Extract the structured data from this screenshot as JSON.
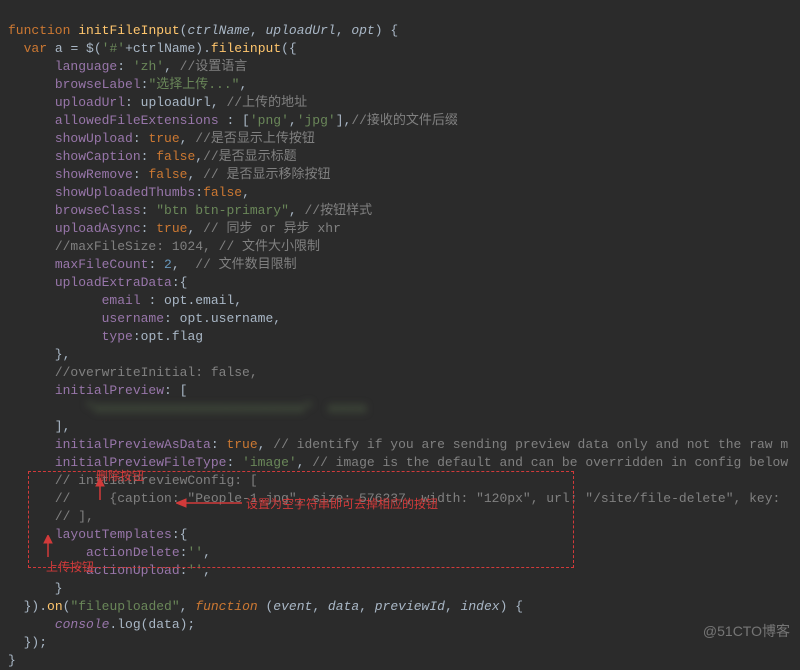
{
  "code": {
    "fn_decl_kw": "function",
    "fn_name": "initFileInput",
    "params": [
      "ctrlName",
      "uploadUrl",
      "opt"
    ],
    "var_kw": "var",
    "var_a": "a",
    "jq_prefix": "$(",
    "hash": "'#'",
    "plus": "+",
    "ctrl": "ctrlName",
    "fileinput": "fileinput",
    "opts": {
      "language": {
        "k": "language",
        "v": "'zh'",
        "c": "//设置语言"
      },
      "browseLabel": {
        "k": "browseLabel",
        "v": "\"选择上传...\""
      },
      "uploadUrl": {
        "k": "uploadUrl",
        "v": "uploadUrl",
        "c": "//上传的地址"
      },
      "allowedFileExtensions": {
        "k": "allowedFileExtensions",
        "v": "['png','jpg']",
        "c": "//接收的文件后缀"
      },
      "showUpload": {
        "k": "showUpload",
        "v": "true",
        "c": "//是否显示上传按钮"
      },
      "showCaption": {
        "k": "showCaption",
        "v": "false",
        "c": "//是否显示标题"
      },
      "showRemove": {
        "k": "showRemove",
        "v": "false",
        "c": "// 是否显示移除按钮"
      },
      "showUploadedThumbs": {
        "k": "showUploadedThumbs",
        "v": "false"
      },
      "browseClass": {
        "k": "browseClass",
        "v": "\"btn btn-primary\"",
        "c": "//按钮样式"
      },
      "uploadAsync": {
        "k": "uploadAsync",
        "v": "true",
        "c": "// 同步 or 异步 xhr"
      },
      "maxFileSize_c": "//maxFileSize: 1024, // 文件大小限制",
      "maxFileCount": {
        "k": "maxFileCount",
        "v": "2",
        "c": "// 文件数目限制"
      },
      "uploadExtraData": {
        "k": "uploadExtraData",
        "email": "email : opt.email,",
        "username": "username: opt.username,",
        "type": "type:opt.flag"
      },
      "overwrite_c": "//overwriteInitial: false,",
      "initialPreview": {
        "k": "initialPreview"
      },
      "initialPreviewAsData": {
        "k": "initialPreviewAsData",
        "v": "true",
        "c": "// identify if you are sending preview data only and not the raw m"
      },
      "initialPreviewFileType": {
        "k": "initialPreviewFileType",
        "v": "'image'",
        "c": "// image is the default and can be overridden in config below"
      },
      "ipc_c1": "// initialPreviewConfig: [",
      "ipc_c2": "//     {caption: \"People-1.jpg\", size: 576237, width: \"120px\", url: \"/site/file-delete\", key:",
      "ipc_c3": "// ],",
      "layoutTemplates": {
        "k": "layoutTemplates",
        "actionDelete": "actionDelete:",
        "actionUpload": "actionUpload:",
        "empty": "''"
      }
    },
    "on": {
      "evt": "\"fileuploaded\"",
      "fn_kw": "function",
      "params": [
        "event",
        "data",
        "previewId",
        "index"
      ],
      "body": "console.log(data);"
    }
  },
  "annotations": {
    "delete_label": "删除按钮",
    "upload_label": "上传按钮",
    "tip": "设置为空字符串即可去掉相应的按钮"
  },
  "watermark": "@51CTO博客"
}
